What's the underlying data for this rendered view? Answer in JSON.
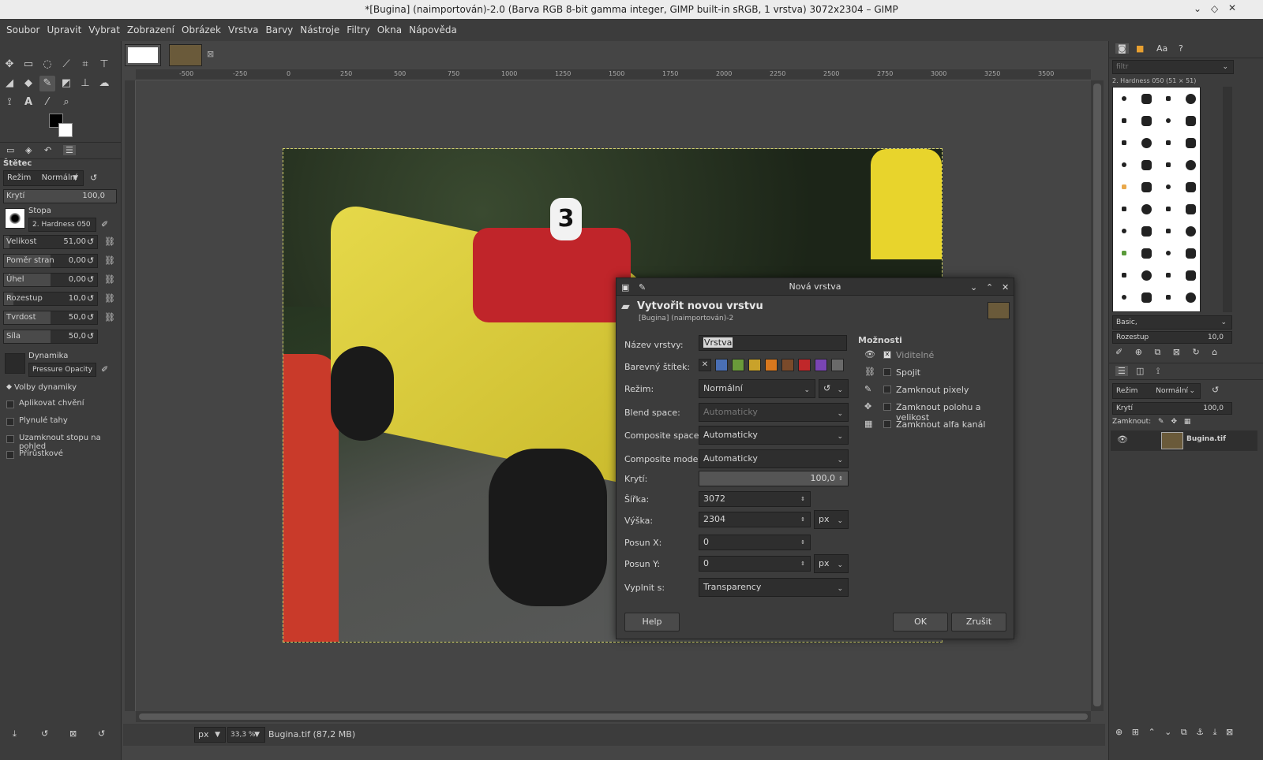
{
  "window": {
    "title": "*[Bugina] (naimportován)-2.0 (Barva RGB 8-bit gamma integer, GIMP built-in sRGB, 1 vrstva) 3072x2304 – GIMP"
  },
  "menu": [
    "Soubor",
    "Upravit",
    "Vybrat",
    "Zobrazení",
    "Obrázek",
    "Vrstva",
    "Barvy",
    "Nástroje",
    "Filtry",
    "Okna",
    "Nápověda"
  ],
  "tool_options": {
    "title": "Štětec",
    "mode_label": "Režim",
    "mode_value": "Normální",
    "opacity_label": "Krytí",
    "opacity_value": "100,0",
    "brush_label": "Stopa",
    "brush_value": "2. Hardness 050",
    "sliders": [
      {
        "label": "Velikost",
        "value": "51,00",
        "fill": 0.06
      },
      {
        "label": "Poměr stran",
        "value": "0,00",
        "fill": 0.5
      },
      {
        "label": "Úhel",
        "value": "0,00",
        "fill": 0.5
      },
      {
        "label": "Rozestup",
        "value": "10,0",
        "fill": 0.1
      },
      {
        "label": "Tvrdost",
        "value": "50,0",
        "fill": 0.5
      },
      {
        "label": "Síla",
        "value": "50,0",
        "fill": 0.5
      }
    ],
    "dynamics_label": "Dynamika",
    "dynamics_value": "Pressure Opacity",
    "dynamics_options_label": "Volby dynamiky",
    "checks": [
      "Aplikovat chvění",
      "Plynulé tahy",
      "Uzamknout stopu na pohled",
      "Přírůstkové"
    ]
  },
  "ruler_ticks": [
    "-500",
    "-250",
    "0",
    "250",
    "500",
    "750",
    "1000",
    "1250",
    "1500",
    "1750",
    "2000",
    "2250",
    "2500",
    "2750",
    "3000",
    "3250",
    "3500"
  ],
  "dialog": {
    "window_title": "Nová vrstva",
    "heading": "Vytvořit novou vrstvu",
    "subheading": "[Bugina] (naimportován)-2",
    "name_label": "Název vrstvy:",
    "name_value": "Vrstva",
    "color_tag_label": "Barevný štítek:",
    "color_tags": [
      "#4a6fb5",
      "#6a9a3a",
      "#c9a22a",
      "#d9781e",
      "#7a4a2a",
      "#c0282a",
      "#7a45b5",
      "#6a6a6a"
    ],
    "mode_label": "Režim:",
    "mode_value": "Normální",
    "blend_label": "Blend space:",
    "blend_value": "Automaticky",
    "composite_space_label": "Composite space:",
    "composite_space_value": "Automaticky",
    "composite_mode_label": "Composite mode:",
    "composite_mode_value": "Automaticky",
    "opacity_label": "Krytí:",
    "opacity_value": "100,0",
    "width_label": "Šířka:",
    "width_value": "3072",
    "height_label": "Výška:",
    "height_value": "2304",
    "unit": "px",
    "offx_label": "Posun X:",
    "offx_value": "0",
    "offy_label": "Posun Y:",
    "offy_value": "0",
    "fill_label": "Vyplnit s:",
    "fill_value": "Transparency",
    "options_title": "Možnosti",
    "options": [
      "Viditelné",
      "Spojit",
      "Zamknout pixely",
      "Zamknout polohu a velikost",
      "Zamknout alfa kanál"
    ],
    "help_label": "Help",
    "ok_label": "OK",
    "cancel_label": "Zrušit"
  },
  "right_panel": {
    "filter_placeholder": "filtr",
    "brush_name": "2. Hardness 050 (51 × 51)",
    "preset": "Basic,",
    "spacing_label": "Rozestup",
    "spacing_value": "10,0",
    "mode_label": "Režim",
    "mode_value": "Normální",
    "opacity_label": "Krytí",
    "opacity_value": "100,0",
    "lock_label": "Zamknout:",
    "layer_name": "Bugina.tif"
  },
  "status": {
    "unit": "px",
    "zoom": "33,3 %",
    "file": "Bugina.tif (87,2 MB)"
  }
}
